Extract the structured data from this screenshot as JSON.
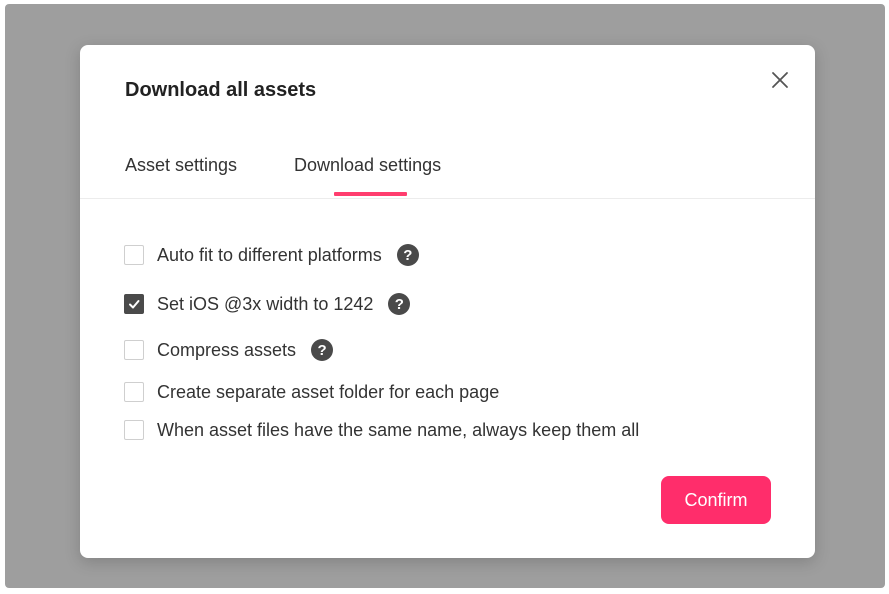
{
  "dialog": {
    "title": "Download all assets",
    "close_icon": "close-icon"
  },
  "tabs": [
    {
      "label": "Asset settings",
      "active": false
    },
    {
      "label": "Download settings",
      "active": true
    }
  ],
  "accent_color": "#ff2d6b",
  "options": [
    {
      "label": "Auto fit to different platforms",
      "checked": false,
      "help": true
    },
    {
      "label": "Set iOS @3x width to 1242",
      "checked": true,
      "help": true
    },
    {
      "label": "Compress assets",
      "checked": false,
      "help": true
    },
    {
      "label": "Create separate asset folder for each page",
      "checked": false,
      "help": false
    },
    {
      "label": "When asset files have the same name, always keep them all",
      "checked": false,
      "help": false
    }
  ],
  "help_icon_glyph": "?",
  "confirm_label": "Confirm"
}
